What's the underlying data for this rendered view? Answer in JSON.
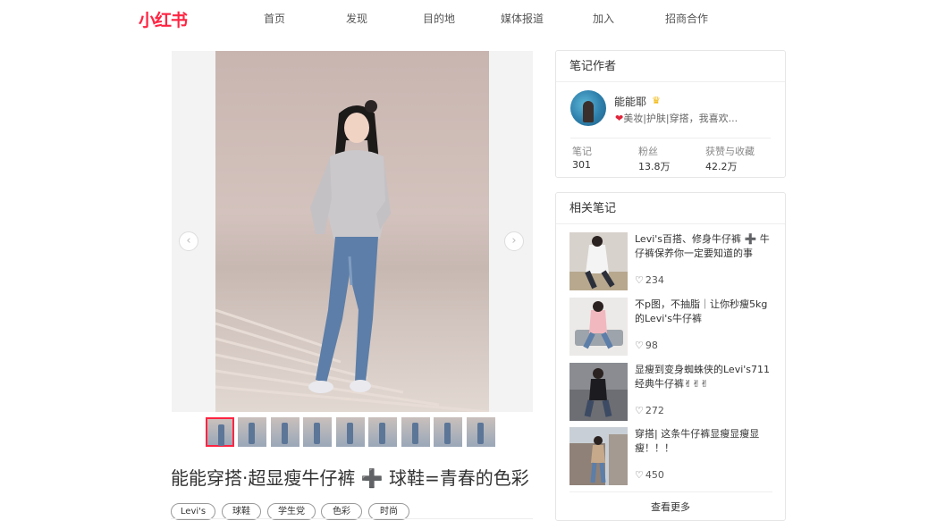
{
  "header": {
    "logo": "小红书",
    "nav": [
      "首页",
      "发现",
      "目的地",
      "媒体报道",
      "加入",
      "招商合作"
    ]
  },
  "gallery": {
    "prev_icon": "chevron-left-icon",
    "next_icon": "chevron-right-icon",
    "prev_glyph": "‹",
    "next_glyph": "›",
    "thumbnail_count": 9,
    "active_index": 0
  },
  "note": {
    "title": "能能穿搭·超显瘦牛仔裤 ➕ 球鞋=青春的色彩",
    "tags": [
      "Levi's",
      "球鞋",
      "学生党",
      "色彩",
      "时尚"
    ]
  },
  "author_card": {
    "heading": "笔记作者",
    "name": "能能耶",
    "crown": "♛",
    "heart": "❤",
    "bio": "美妆|护肤|穿搭，我喜欢...",
    "stats": [
      {
        "label": "笔记",
        "value": "301"
      },
      {
        "label": "粉丝",
        "value": "13.8万"
      },
      {
        "label": "获赞与收藏",
        "value": "42.2万"
      }
    ]
  },
  "related_card": {
    "heading": "相关笔记",
    "heart_glyph": "♡",
    "items": [
      {
        "title": "Levi's百搭、修身牛仔裤 ➕ 牛仔裤保养你一定要知道的事",
        "likes": "234"
      },
      {
        "title": "不p图，不抽脂｜让你秒瘦5kg的Levi's牛仔裤",
        "likes": "98"
      },
      {
        "title": "显瘦到变身蜘蛛侠的Levi's711经典牛仔裤✌✌✌",
        "likes": "272"
      },
      {
        "title": "穿搭| 这条牛仔裤显瘦显瘦显瘦！！！",
        "likes": "450"
      }
    ],
    "more": "查看更多"
  },
  "colors": {
    "brand": "#ff2442",
    "denim": "#5c7ea8",
    "text": "#333333"
  }
}
